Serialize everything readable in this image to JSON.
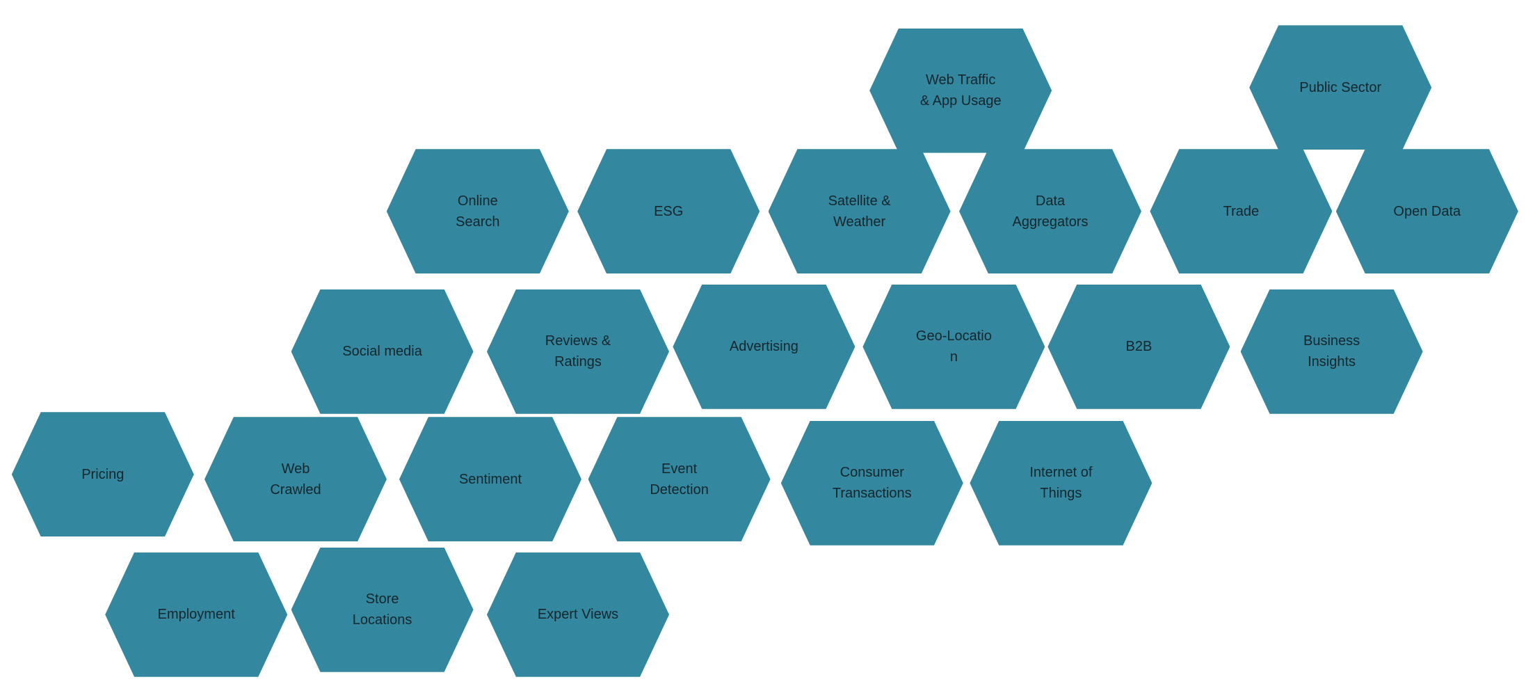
{
  "colors": {
    "hex_fill": "#33879e",
    "text": "#15262c"
  },
  "hexagons": [
    {
      "label": "Web Traffic\n& App Usage"
    },
    {
      "label": "Public Sector"
    },
    {
      "label": "Online\nSearch"
    },
    {
      "label": "ESG"
    },
    {
      "label": "Satellite &\nWeather"
    },
    {
      "label": "Data\nAggregators"
    },
    {
      "label": "Trade"
    },
    {
      "label": "Open Data"
    },
    {
      "label": "Social media"
    },
    {
      "label": "Reviews &\nRatings"
    },
    {
      "label": "Advertising"
    },
    {
      "label": "Geo-Locatio\nn"
    },
    {
      "label": "B2B"
    },
    {
      "label": "Business\nInsights"
    },
    {
      "label": "Pricing"
    },
    {
      "label": "Web\nCrawled"
    },
    {
      "label": "Sentiment"
    },
    {
      "label": "Event\nDetection"
    },
    {
      "label": "Consumer\nTransactions"
    },
    {
      "label": "Internet of\nThings"
    },
    {
      "label": "Employment"
    },
    {
      "label": "Store\nLocations"
    },
    {
      "label": "Expert Views"
    }
  ]
}
